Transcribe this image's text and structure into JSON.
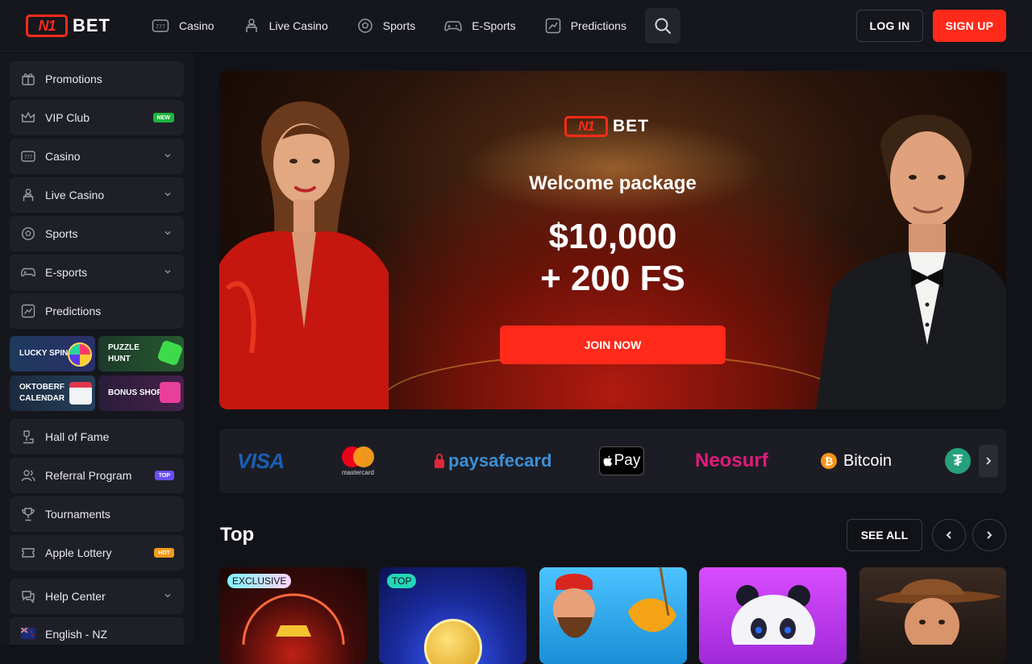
{
  "brand": {
    "logo_mark": "N1",
    "logo_text": "BET"
  },
  "nav": {
    "items": [
      {
        "label": "Casino",
        "icon": "slot-777-icon"
      },
      {
        "label": "Live Casino",
        "icon": "dealer-icon"
      },
      {
        "label": "Sports",
        "icon": "soccer-ball-icon"
      },
      {
        "label": "E-Sports",
        "icon": "gamepad-icon"
      },
      {
        "label": "Predictions",
        "icon": "chart-icon"
      }
    ],
    "search_icon": "search-icon",
    "login_label": "LOG IN",
    "signup_label": "SIGN UP"
  },
  "sidebar": {
    "items": [
      {
        "label": "Promotions",
        "icon": "gift-icon"
      },
      {
        "label": "VIP Club",
        "icon": "crown-icon",
        "badge": "NEW"
      },
      {
        "label": "Casino",
        "icon": "slot-777-icon",
        "chevron": true
      },
      {
        "label": "Live Casino",
        "icon": "dealer-icon",
        "chevron": true
      },
      {
        "label": "Sports",
        "icon": "soccer-ball-icon",
        "chevron": true
      },
      {
        "label": "E-sports",
        "icon": "gamepad-icon",
        "chevron": true
      },
      {
        "label": "Predictions",
        "icon": "chart-icon"
      }
    ],
    "tiles": [
      {
        "label": "LUCKY SPIN"
      },
      {
        "label": "PUZZLE HUNT"
      },
      {
        "label": "OKTOBERF CALENDAR"
      },
      {
        "label": "BONUS SHOP"
      }
    ],
    "items_lower": [
      {
        "label": "Hall of Fame",
        "icon": "trophy-stand-icon"
      },
      {
        "label": "Referral Program",
        "icon": "users-icon",
        "badge": "TOP"
      },
      {
        "label": "Tournaments",
        "icon": "cup-icon"
      },
      {
        "label": "Apple Lottery",
        "icon": "ticket-icon",
        "badge": "HOT"
      },
      {
        "label": "Help Center",
        "icon": "chat-help-icon",
        "chevron": true
      },
      {
        "label": "English - NZ",
        "icon": "flag-nz-icon"
      }
    ]
  },
  "hero": {
    "logo_mark": "N1",
    "logo_text": "BET",
    "title": "Welcome package",
    "amount_line1": "$10,000",
    "amount_line2": "+ 200 FS",
    "cta": "JOIN NOW"
  },
  "payments": [
    "VISA",
    "mastercard",
    "paysafecard",
    "Pay",
    "Neosurf",
    "Bitcoin"
  ],
  "top_section": {
    "title": "Top",
    "see_all": "SEE ALL",
    "games": [
      {
        "tag": "EXCLUSIVE"
      },
      {
        "tag": "TOP"
      },
      {
        "tag": ""
      },
      {
        "tag": ""
      },
      {
        "tag": ""
      }
    ]
  },
  "colors": {
    "accent": "#ff2a1a",
    "bg": "#121318",
    "panel": "#1f2027"
  }
}
